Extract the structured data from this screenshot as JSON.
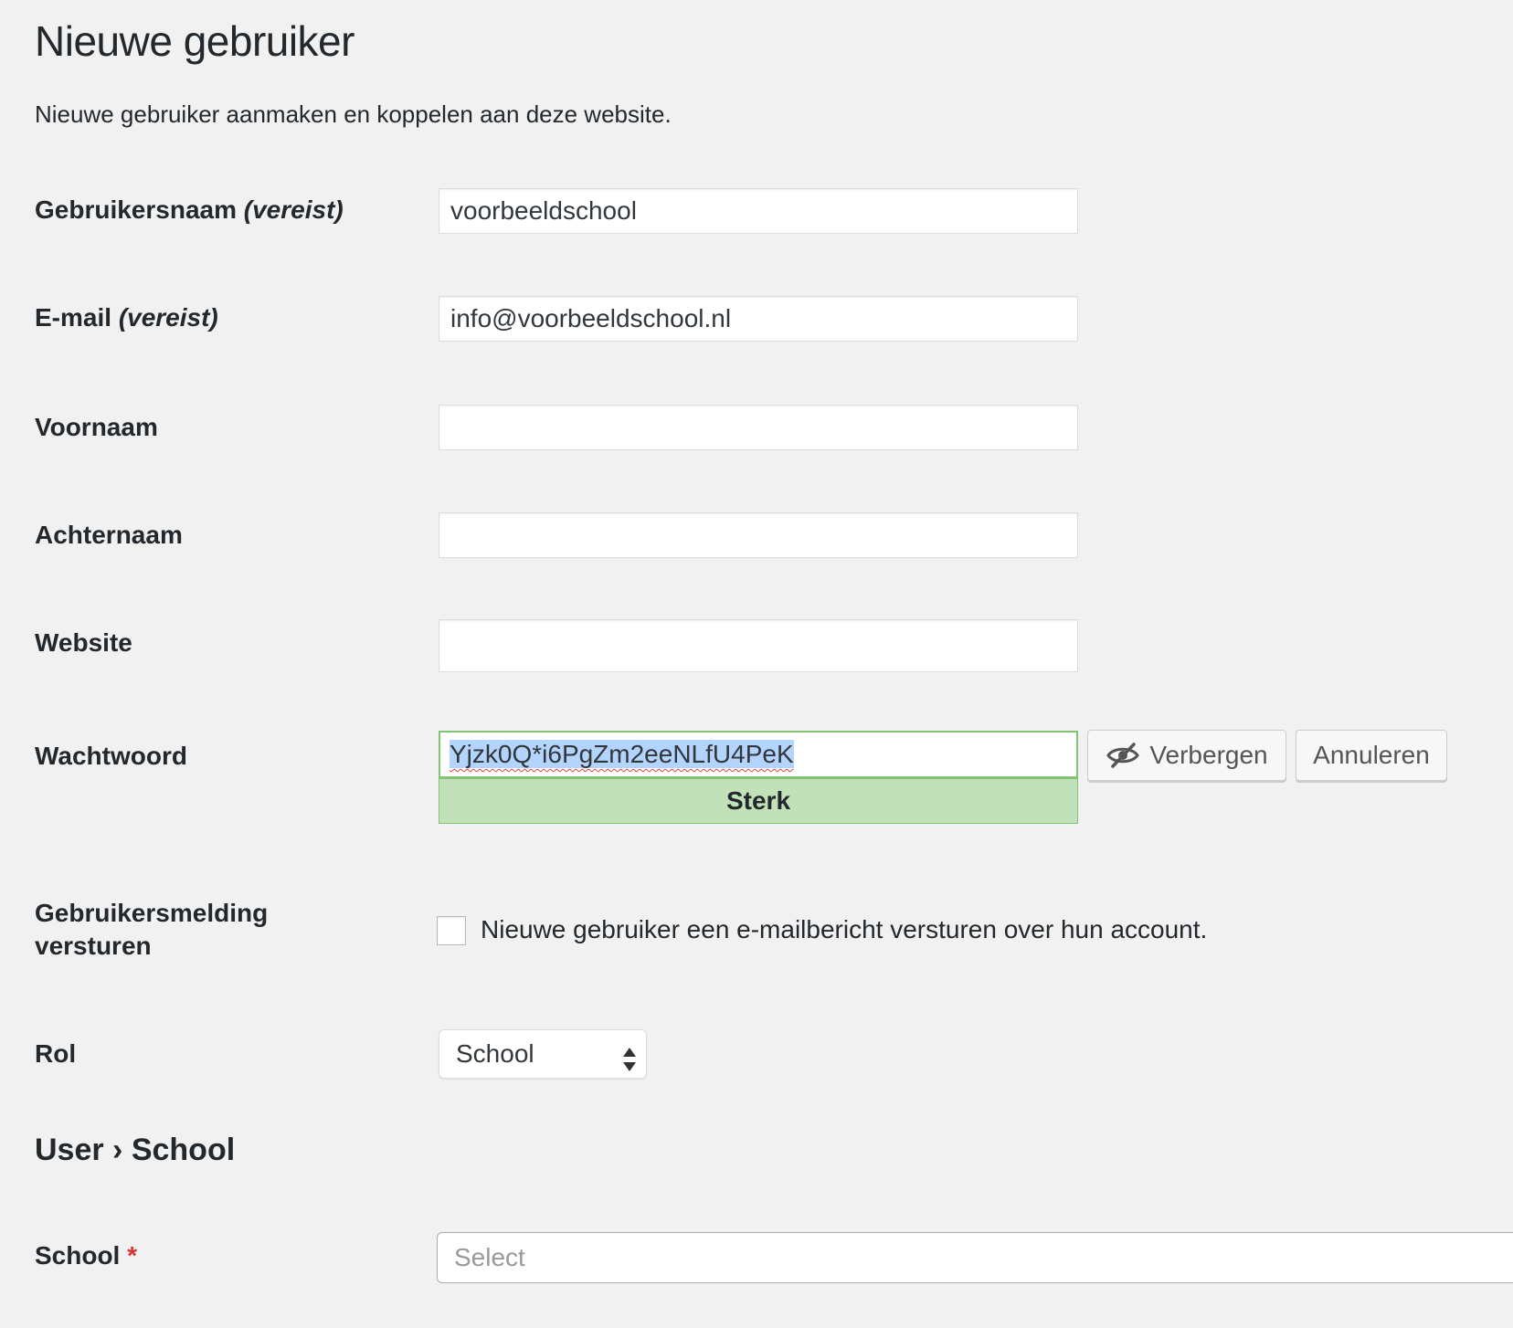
{
  "page": {
    "title": "Nieuwe gebruiker",
    "intro": "Nieuwe gebruiker aanmaken en koppelen aan deze website."
  },
  "fields": {
    "username": {
      "label": "Gebruikersnaam",
      "required": "(vereist)",
      "value": "voorbeeldschool"
    },
    "email": {
      "label": "E-mail",
      "required": "(vereist)",
      "value": "info@voorbeeldschool.nl"
    },
    "first_name": {
      "label": "Voornaam",
      "value": ""
    },
    "last_name": {
      "label": "Achternaam",
      "value": ""
    },
    "website": {
      "label": "Website",
      "value": ""
    },
    "password": {
      "label": "Wachtwoord",
      "value": "Yjzk0Q*i6PgZm2eeNLfU4PeK",
      "strength": "Sterk",
      "hide_button": "Verbergen",
      "cancel_button": "Annuleren"
    },
    "notify": {
      "label_line1": "Gebruikersmelding",
      "label_line2": "versturen",
      "checkbox_label": "Nieuwe gebruiker een e-mailbericht versturen over hun account.",
      "checked": false
    },
    "role": {
      "label": "Rol",
      "selected": "School"
    }
  },
  "user_school": {
    "section_title": "User › School",
    "school_label": "School",
    "required_mark": "*",
    "school_placeholder": "Select"
  },
  "colors": {
    "background": "#f1f1f1",
    "strength_bg": "#c1e1b9",
    "strength_border": "#83c373",
    "required_star": "#dc3232",
    "selection": "#b3d4fc"
  },
  "icons": {
    "hide_password": "eye-slash-icon",
    "select_arrows": "sort-arrows-icon"
  }
}
